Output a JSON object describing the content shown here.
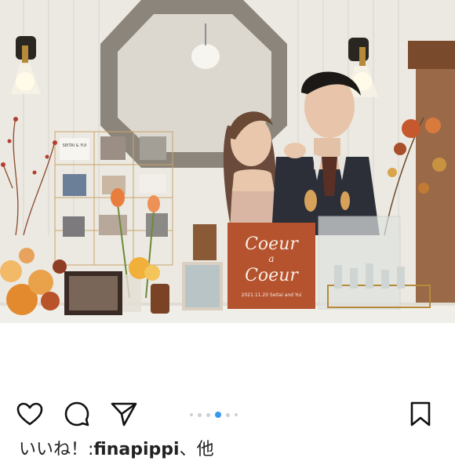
{
  "post": {
    "sign": {
      "line1": "Coeur",
      "line2": "a",
      "line3": "Coeur",
      "date_line": "2021.11.20  Seitai and Yui"
    },
    "collage_label": "SEITAI & YUI"
  },
  "actions": {
    "like_icon": "heart-icon",
    "comment_icon": "comment-icon",
    "share_icon": "send-icon",
    "save_icon": "bookmark-icon"
  },
  "carousel": {
    "total": 6,
    "active_index": 3,
    "active_color": "#3897f0"
  },
  "likes": {
    "prefix": "いいね！:",
    "user": "finapippi",
    "suffix": "、他"
  },
  "colors": {
    "sign": "#b5532e",
    "flowers": "#e07a3a"
  }
}
